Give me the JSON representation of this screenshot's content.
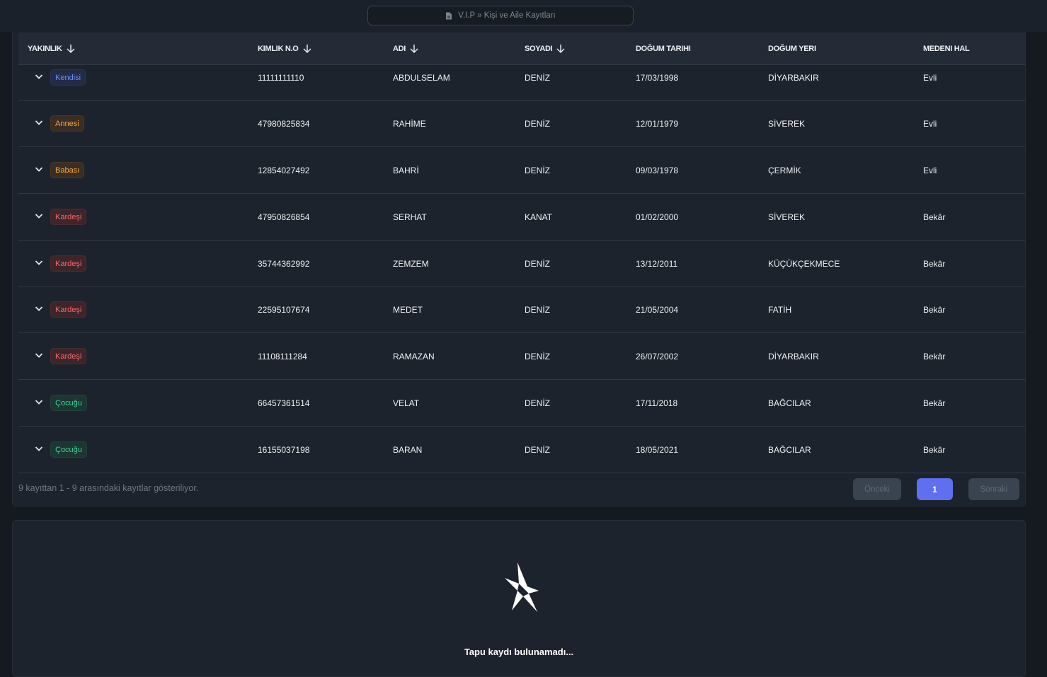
{
  "breadcrumb": {
    "text": "V.I.P » Kişi ve Aile Kayıtları",
    "icon": "document-icon"
  },
  "table": {
    "columns": [
      {
        "label": "YAKINLIK",
        "sortable": true
      },
      {
        "label": "KIMLIK N.O",
        "sortable": true
      },
      {
        "label": "ADI",
        "sortable": true
      },
      {
        "label": "SOYADI",
        "sortable": true
      },
      {
        "label": "DOĞUM TARIHI",
        "sortable": false
      },
      {
        "label": "DOĞUM YERI",
        "sortable": false
      },
      {
        "label": "MEDENI HAL",
        "sortable": false
      }
    ],
    "rows": [
      {
        "relation": "Kendisi",
        "relation_color": "blue",
        "id": "11111111110",
        "name": "ABDULSELAM",
        "surname": "DENİZ",
        "birth_date": "17/03/1998",
        "birth_place": "DİYARBAKIR",
        "marital": "Evli"
      },
      {
        "relation": "Annesi",
        "relation_color": "orange",
        "id": "47980825834",
        "name": "RAHİME",
        "surname": "DENİZ",
        "birth_date": "12/01/1979",
        "birth_place": "SİVEREK",
        "marital": "Evli"
      },
      {
        "relation": "Babası",
        "relation_color": "orange",
        "id": "12854027492",
        "name": "BAHRİ",
        "surname": "DENİZ",
        "birth_date": "09/03/1978",
        "birth_place": "ÇERMİK",
        "marital": "Evli"
      },
      {
        "relation": "Kardeşi",
        "relation_color": "red",
        "id": "47950826854",
        "name": "SERHAT",
        "surname": "KANAT",
        "birth_date": "01/02/2000",
        "birth_place": "SİVEREK",
        "marital": "Bekâr"
      },
      {
        "relation": "Kardeşi",
        "relation_color": "red",
        "id": "35744362992",
        "name": "ZEMZEM",
        "surname": "DENİZ",
        "birth_date": "13/12/2011",
        "birth_place": "KÜÇÜKÇEKMECE",
        "marital": "Bekâr"
      },
      {
        "relation": "Kardeşi",
        "relation_color": "red",
        "id": "22595107674",
        "name": "MEDET",
        "surname": "DENİZ",
        "birth_date": "21/05/2004",
        "birth_place": "FATİH",
        "marital": "Bekâr"
      },
      {
        "relation": "Kardeşi",
        "relation_color": "red",
        "id": "11108111284",
        "name": "RAMAZAN",
        "surname": "DENİZ",
        "birth_date": "26/07/2002",
        "birth_place": "DİYARBAKIR",
        "marital": "Bekâr"
      },
      {
        "relation": "Çocuğu",
        "relation_color": "green",
        "id": "66457361514",
        "name": "VELAT",
        "surname": "DENİZ",
        "birth_date": "17/11/2018",
        "birth_place": "BAĞCILAR",
        "marital": "Bekâr"
      },
      {
        "relation": "Çocuğu",
        "relation_color": "green",
        "id": "16155037198",
        "name": "BARAN",
        "surname": "DENİZ",
        "birth_date": "18/05/2021",
        "birth_place": "BAĞCILAR",
        "marital": "Bekâr"
      }
    ]
  },
  "footer": {
    "info": "9 kayıttan 1 - 9 arasındaki kayıtlar gösteriliyor.",
    "prev_label": "Önceki",
    "page_label": "1",
    "next_label": "Sonraki"
  },
  "empty_state": {
    "message": "Tapu kaydı bulunamadı...",
    "icon": "star-logo-icon"
  },
  "colors": {
    "background": "#151a21",
    "panel": "#1d232c",
    "accent": "#5f6ff0",
    "badge_blue": "#6f8cff",
    "badge_orange": "#f0a64a",
    "badge_red": "#f06a6a",
    "badge_green": "#3fd39a"
  }
}
